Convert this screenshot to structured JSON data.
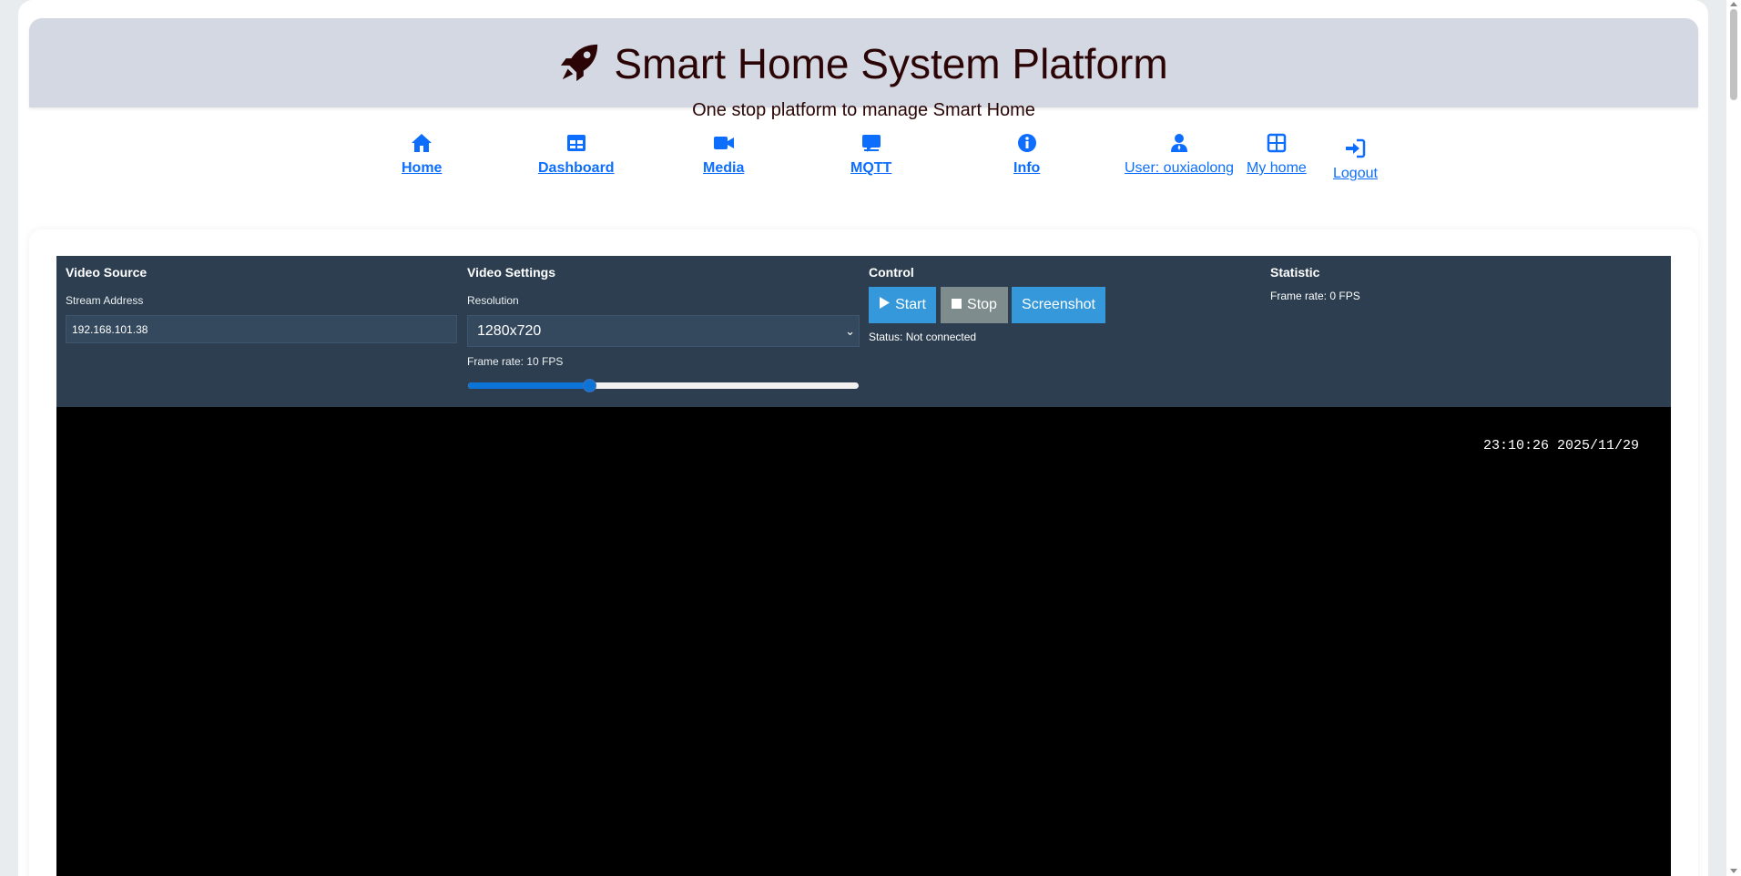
{
  "header": {
    "title": "Smart Home System Platform",
    "subtitle": "One stop platform to manage Smart Home",
    "title_color": "#2b0505",
    "logo_icon": "rocket-icon"
  },
  "nav": {
    "items": [
      {
        "label": "Home",
        "icon": "house-icon"
      },
      {
        "label": "Dashboard",
        "icon": "table-icon"
      },
      {
        "label": "Media",
        "icon": "video-camera-icon"
      },
      {
        "label": "MQTT",
        "icon": "chat-icon"
      },
      {
        "label": "Info",
        "icon": "info-icon"
      },
      {
        "label": "User: ouxiaolong",
        "icon": "user-icon"
      },
      {
        "label": "My home",
        "icon": "grid-icon"
      },
      {
        "label": "Logout",
        "icon": "login-arrow-icon"
      }
    ],
    "link_color": "#0d6efd"
  },
  "video_source": {
    "heading": "Video Source",
    "stream_label": "Stream Address",
    "stream_value": "192.168.101.38"
  },
  "video_settings": {
    "heading": "Video Settings",
    "resolution_label": "Resolution",
    "resolution_value": "1280x720",
    "frame_rate_label": "Frame rate: 10 FPS",
    "frame_rate_slider_fraction": 0.31
  },
  "control": {
    "heading": "Control",
    "start_label": "Start",
    "stop_label": "Stop",
    "screenshot_label": "Screenshot",
    "status_text": "Status: Not connected"
  },
  "statistic": {
    "heading": "Statistic",
    "frame_rate_text": "Frame rate: 0 FPS"
  },
  "video": {
    "timestamp": "23:10:26 2025/11/29"
  },
  "colors": {
    "panel_bg": "#2c3e50",
    "button_blue": "#3498db",
    "button_gray": "#7f8c8d"
  }
}
